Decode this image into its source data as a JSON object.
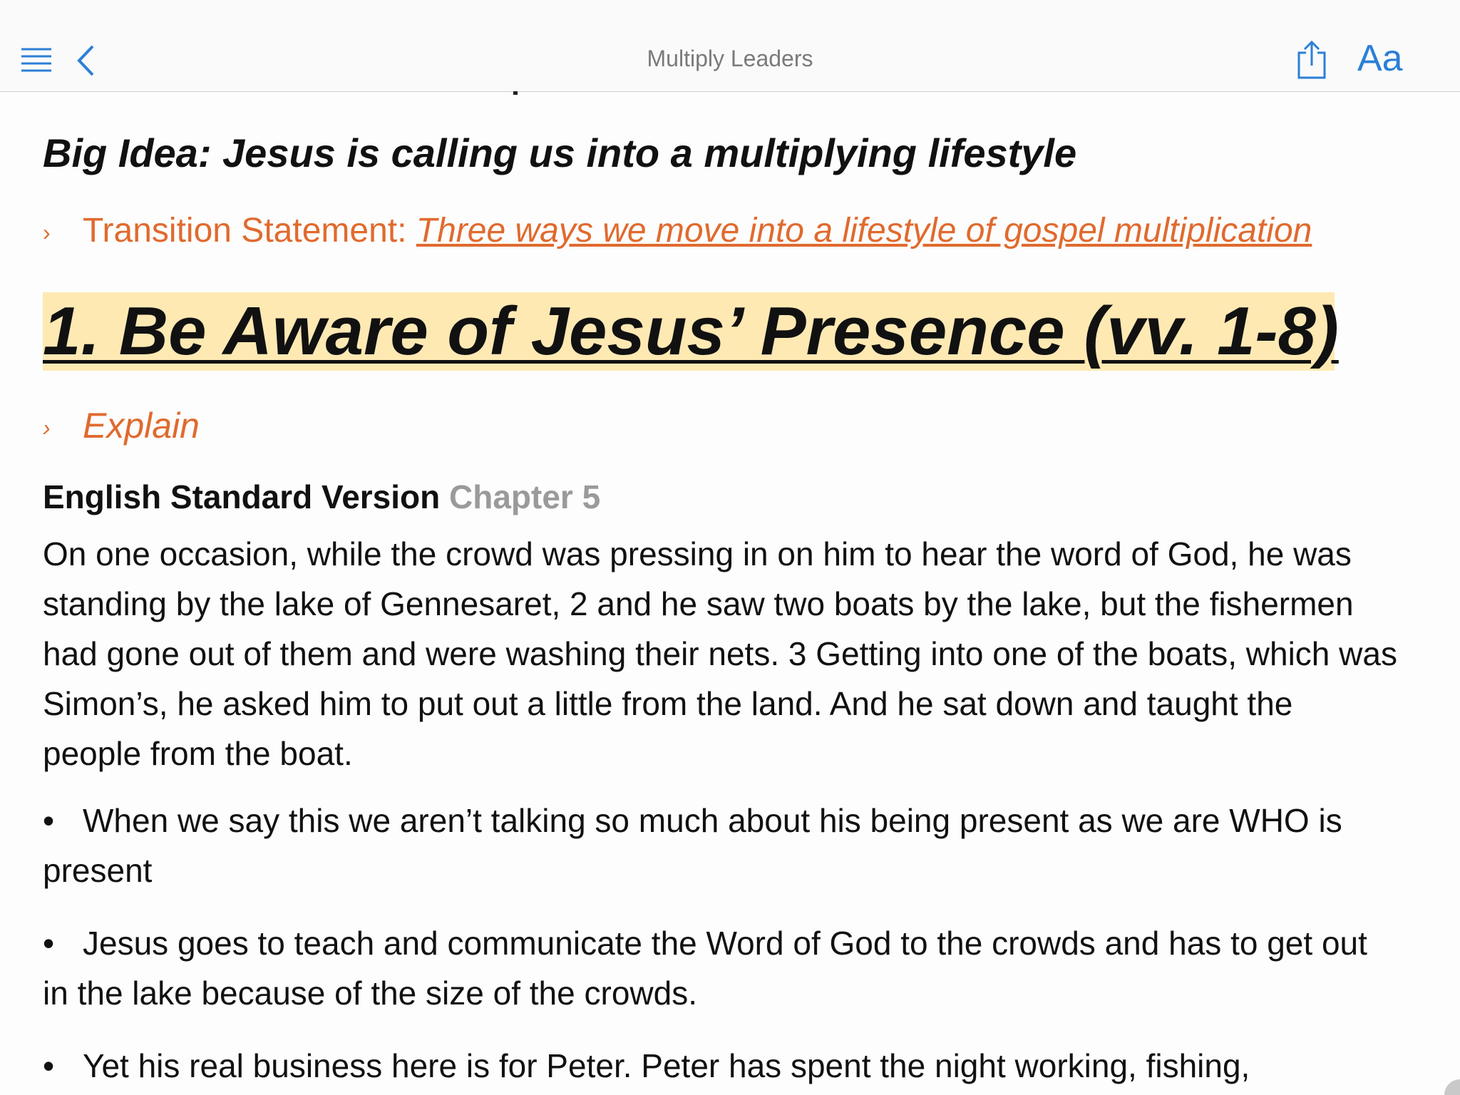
{
  "header": {
    "title": "Multiply Leaders",
    "menu_icon": "hamburger-menu-icon",
    "back_icon": "chevron-left-icon",
    "share_icon": "share-icon",
    "font_button": "Aa",
    "accent": "#2b7fd6"
  },
  "content": {
    "big_idea": "Big Idea: Jesus is calling us into a multiplying lifestyle",
    "transition_chevron": "›",
    "transition_label": "Transition Statement: ",
    "transition_link": "Three ways we move into a lifestyle of gospel multiplication",
    "heading": "1. Be Aware of Jesus’ Presence (vv. 1-8)",
    "explain_chevron": "›",
    "explain": "Explain",
    "version_name": "English Standard Version",
    "version_chapter": "Chapter 5",
    "passage": "On one occasion, while the crowd was pressing in on him to hear the word of God, he was standing by the lake of Gennesaret, 2 and he saw two boats by the lake, but the fishermen had gone out of them and were washing their nets. 3 Getting into one of the boats, which was Simon’s, he asked him to put out a little from the land. And he sat down and taught the people from the boat.",
    "bullet_symbol": "•",
    "bullets": [
      "When we say this we aren’t talking so much about his being present as we are WHO is present",
      "Jesus goes to teach and communicate the Word of God to the crowds and has to get out in the lake because of the size of the crowds.",
      "Yet his real business here is for Peter. Peter has spent the night working, fishing,"
    ],
    "accent_orange": "#e06a2e",
    "highlight_yellow": "#ffe9b3"
  }
}
